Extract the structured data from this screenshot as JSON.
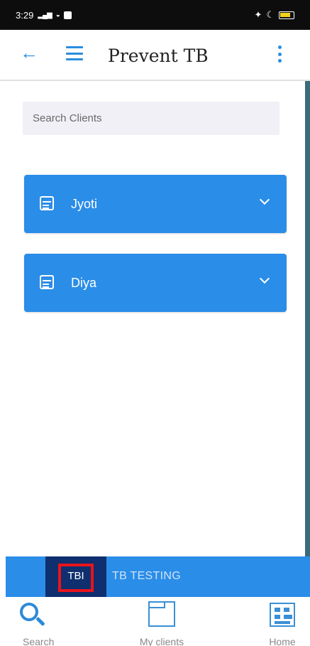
{
  "status_bar": {
    "time": "3:29"
  },
  "app_bar": {
    "title": "Prevent TB"
  },
  "search": {
    "placeholder": "Search Clients"
  },
  "clients": [
    {
      "name": "Jyoti"
    },
    {
      "name": "Diya"
    }
  ],
  "tabs": {
    "active": "TBI",
    "other": "TB TESTING"
  },
  "bottom_nav": [
    {
      "label": "Search",
      "icon": "search-icon"
    },
    {
      "label": "My clients",
      "icon": "clients-icon"
    },
    {
      "label": "Home",
      "icon": "home-icon"
    }
  ],
  "colors": {
    "accent": "#2a8de8",
    "active_tab": "#0f2f6e",
    "highlight": "#e8141c"
  }
}
